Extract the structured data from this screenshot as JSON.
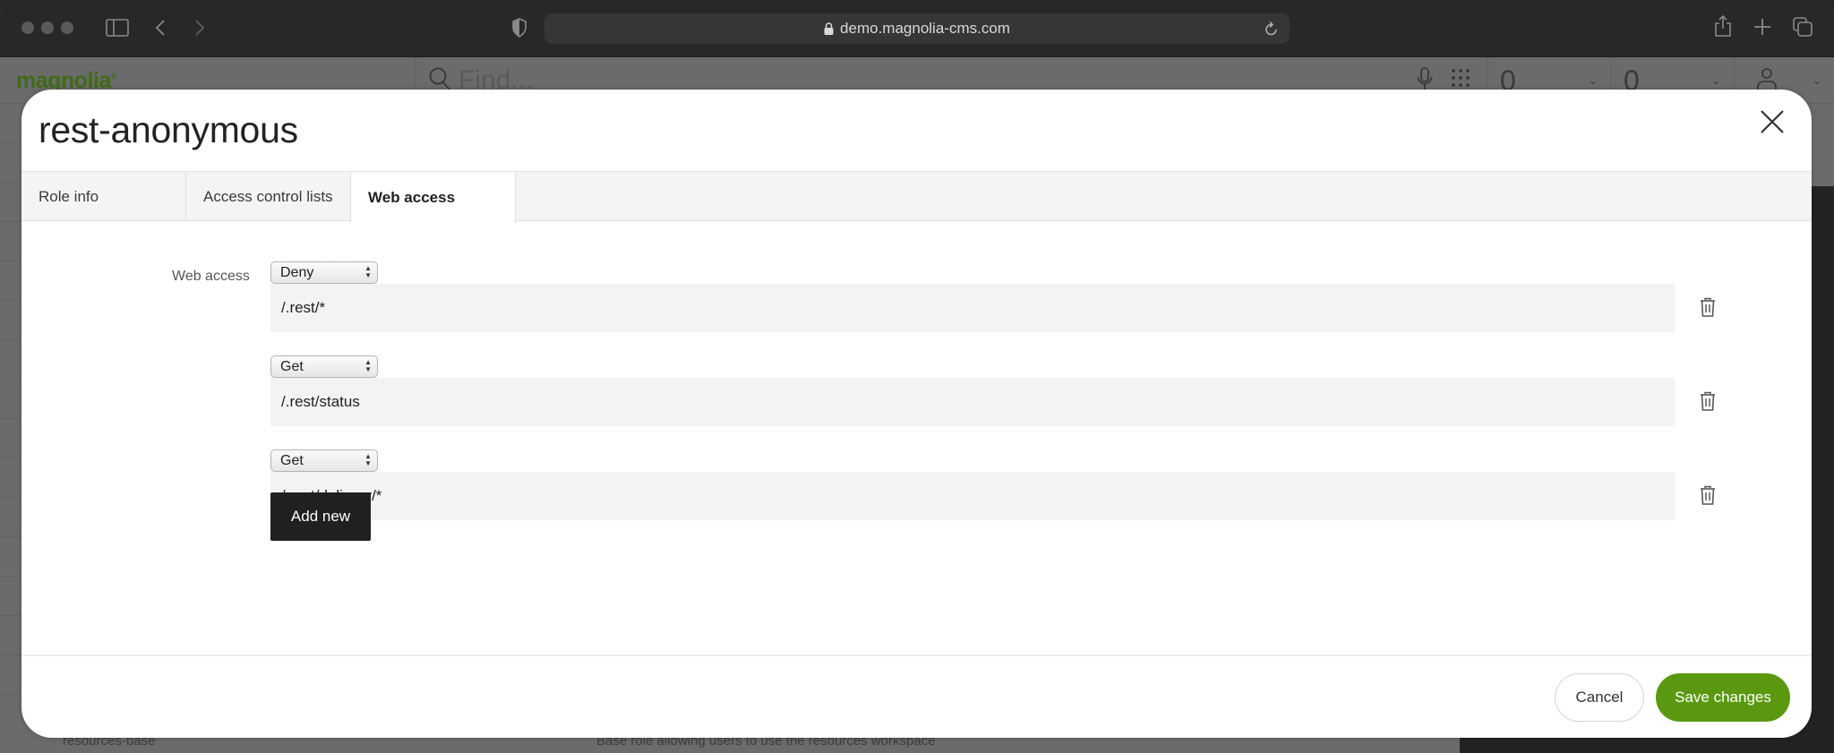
{
  "browser": {
    "url": "demo.magnolia-cms.com"
  },
  "app": {
    "logo": "magnolia",
    "search_placeholder": "Find...",
    "counters": [
      {
        "value": "0"
      },
      {
        "value": "0"
      }
    ],
    "background_row": {
      "name": "resources-base",
      "description": "Base role allowing users to use the resources workspace"
    }
  },
  "dialog": {
    "title": "rest-anonymous",
    "tabs": [
      {
        "label": "Role info",
        "active": false
      },
      {
        "label": "Access control lists",
        "active": false
      },
      {
        "label": "Web access",
        "active": true
      }
    ],
    "field_label": "Web access",
    "entries": [
      {
        "method": "Deny",
        "path": "/.rest/*"
      },
      {
        "method": "Get",
        "path": "/.rest/status"
      },
      {
        "method": "Get",
        "path": "/.rest/delivery/*"
      }
    ],
    "add_new_label": "Add new",
    "cancel_label": "Cancel",
    "save_label": "Save changes"
  },
  "colors": {
    "save_button": "#5a990f",
    "add_button": "#202020"
  }
}
